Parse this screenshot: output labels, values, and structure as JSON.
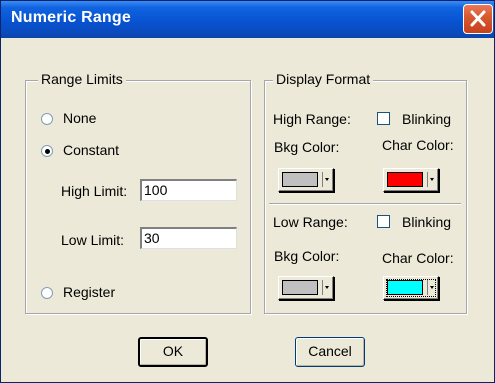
{
  "window": {
    "title": "Numeric Range"
  },
  "range_limits": {
    "legend": "Range Limits",
    "options": [
      {
        "label": "None",
        "selected": false
      },
      {
        "label": "Constant",
        "selected": true
      },
      {
        "label": "Register",
        "selected": false
      }
    ],
    "high_limit": {
      "label": "High Limit:",
      "value": "100"
    },
    "low_limit": {
      "label": "Low Limit:",
      "value": "30"
    }
  },
  "display_format": {
    "legend": "Display Format",
    "high": {
      "label": "High Range:",
      "blinking_label": "Blinking",
      "blinking_checked": false,
      "bkg_label": "Bkg Color:",
      "bkg_color": "#c0c0c0",
      "char_label": "Char Color:",
      "char_color": "#ff0000"
    },
    "low": {
      "label": "Low Range:",
      "blinking_label": "Blinking",
      "blinking_checked": false,
      "bkg_label": "Bkg Color:",
      "bkg_color": "#c0c0c0",
      "char_label": "Char Color:",
      "char_color": "#00ffff"
    }
  },
  "buttons": {
    "ok": "OK",
    "cancel": "Cancel"
  },
  "icons": {
    "close": "close-icon",
    "dropdown": "chevron-down-icon"
  }
}
